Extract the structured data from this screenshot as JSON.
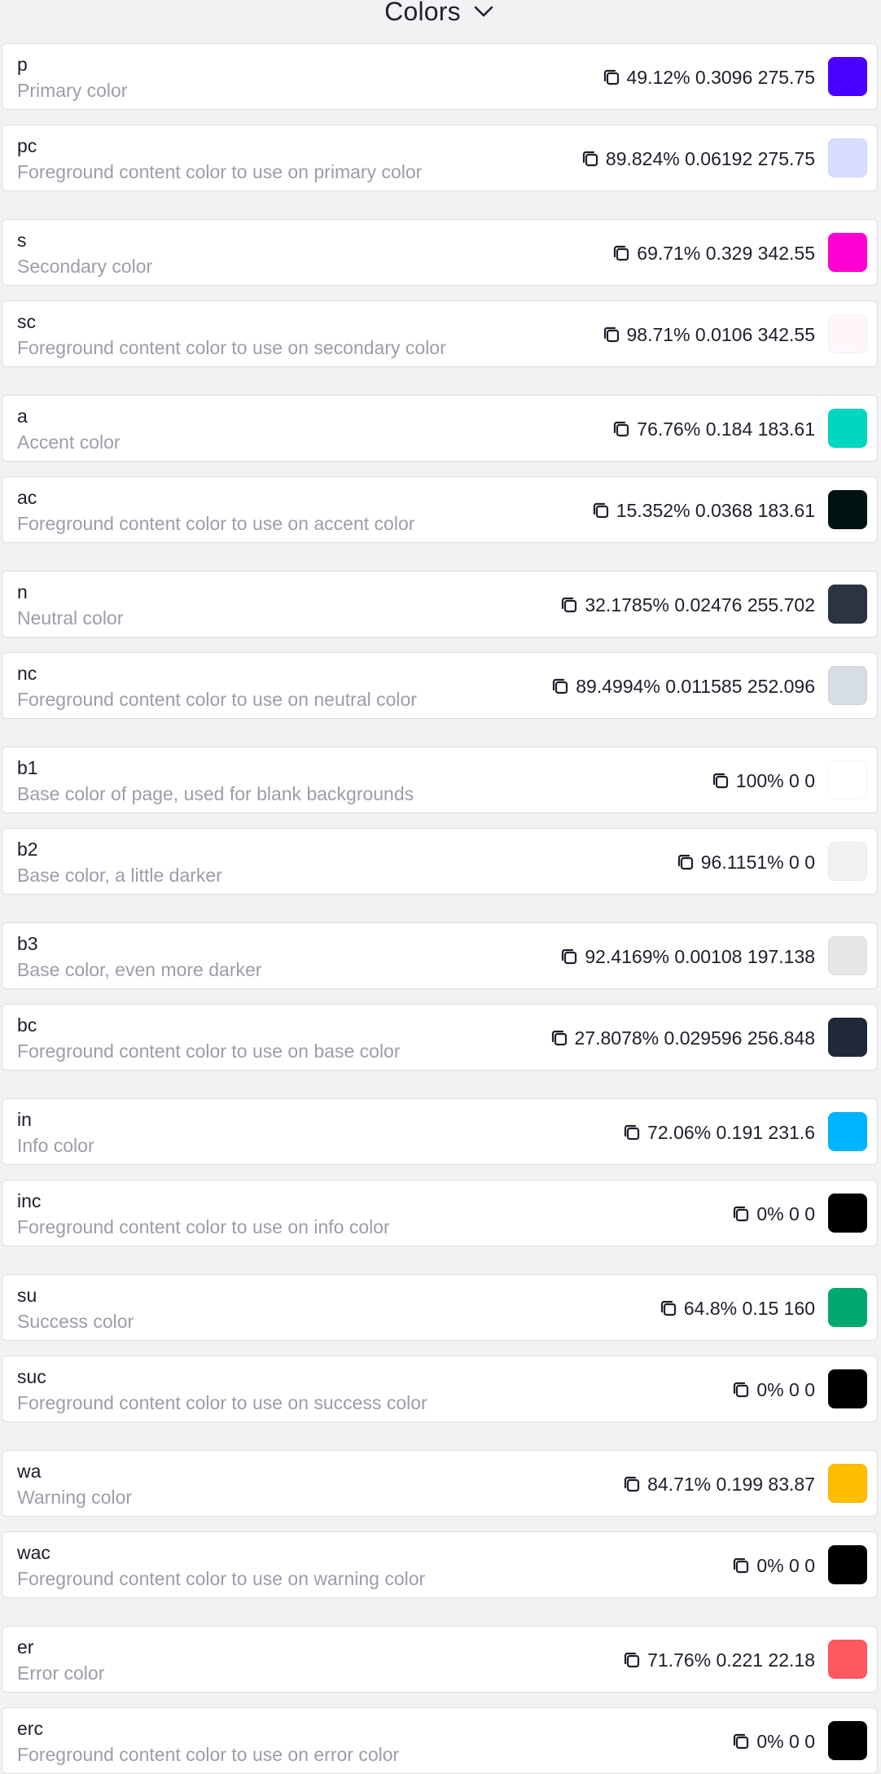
{
  "header": {
    "title": "Colors",
    "chevron_icon": "chevron-down-icon"
  },
  "colors": [
    {
      "name": "p",
      "description": "Primary color",
      "value": "49.12% 0.3096 275.75",
      "swatch": "#4a00ff"
    },
    {
      "name": "pc",
      "description": "Foreground content color to use on primary color",
      "value": "89.824% 0.06192 275.75",
      "swatch": "#d6ddff"
    },
    {
      "name": "s",
      "description": "Secondary color",
      "value": "69.71% 0.329 342.55",
      "swatch": "#ff00d3"
    },
    {
      "name": "sc",
      "description": "Foreground content color to use on secondary color",
      "value": "98.71% 0.0106 342.55",
      "swatch": "#fff7fc"
    },
    {
      "name": "a",
      "description": "Accent color",
      "value": "76.76% 0.184 183.61",
      "swatch": "#00d7c0"
    },
    {
      "name": "ac",
      "description": "Foreground content color to use on accent color",
      "value": "15.352% 0.0368 183.61",
      "swatch": "#011310"
    },
    {
      "name": "n",
      "description": "Neutral color",
      "value": "32.1785% 0.02476 255.702",
      "swatch": "#2b3440"
    },
    {
      "name": "nc",
      "description": "Foreground content color to use on neutral color",
      "value": "89.4994% 0.011585 252.096",
      "swatch": "#d7dde4"
    },
    {
      "name": "b1",
      "description": "Base color of page, used for blank backgrounds",
      "value": "100% 0 0",
      "swatch": "#ffffff"
    },
    {
      "name": "b2",
      "description": "Base color, a little darker",
      "value": "96.1151% 0 0",
      "swatch": "#f2f2f2"
    },
    {
      "name": "b3",
      "description": "Base color, even more darker",
      "value": "92.4169% 0.00108 197.138",
      "swatch": "#e5e6e6"
    },
    {
      "name": "bc",
      "description": "Foreground content color to use on base color",
      "value": "27.8078% 0.029596 256.848",
      "swatch": "#1f2937"
    },
    {
      "name": "in",
      "description": "Info color",
      "value": "72.06% 0.191 231.6",
      "swatch": "#00b5ff"
    },
    {
      "name": "inc",
      "description": "Foreground content color to use on info color",
      "value": "0% 0 0",
      "swatch": "#000000"
    },
    {
      "name": "su",
      "description": "Success color",
      "value": "64.8% 0.15 160",
      "swatch": "#00a96e"
    },
    {
      "name": "suc",
      "description": "Foreground content color to use on success color",
      "value": "0% 0 0",
      "swatch": "#000000"
    },
    {
      "name": "wa",
      "description": "Warning color",
      "value": "84.71% 0.199 83.87",
      "swatch": "#ffbe00"
    },
    {
      "name": "wac",
      "description": "Foreground content color to use on warning color",
      "value": "0% 0 0",
      "swatch": "#000000"
    },
    {
      "name": "er",
      "description": "Error color",
      "value": "71.76% 0.221 22.18",
      "swatch": "#ff5861"
    },
    {
      "name": "erc",
      "description": "Foreground content color to use on error color",
      "value": "0% 0 0",
      "swatch": "#000000"
    }
  ]
}
